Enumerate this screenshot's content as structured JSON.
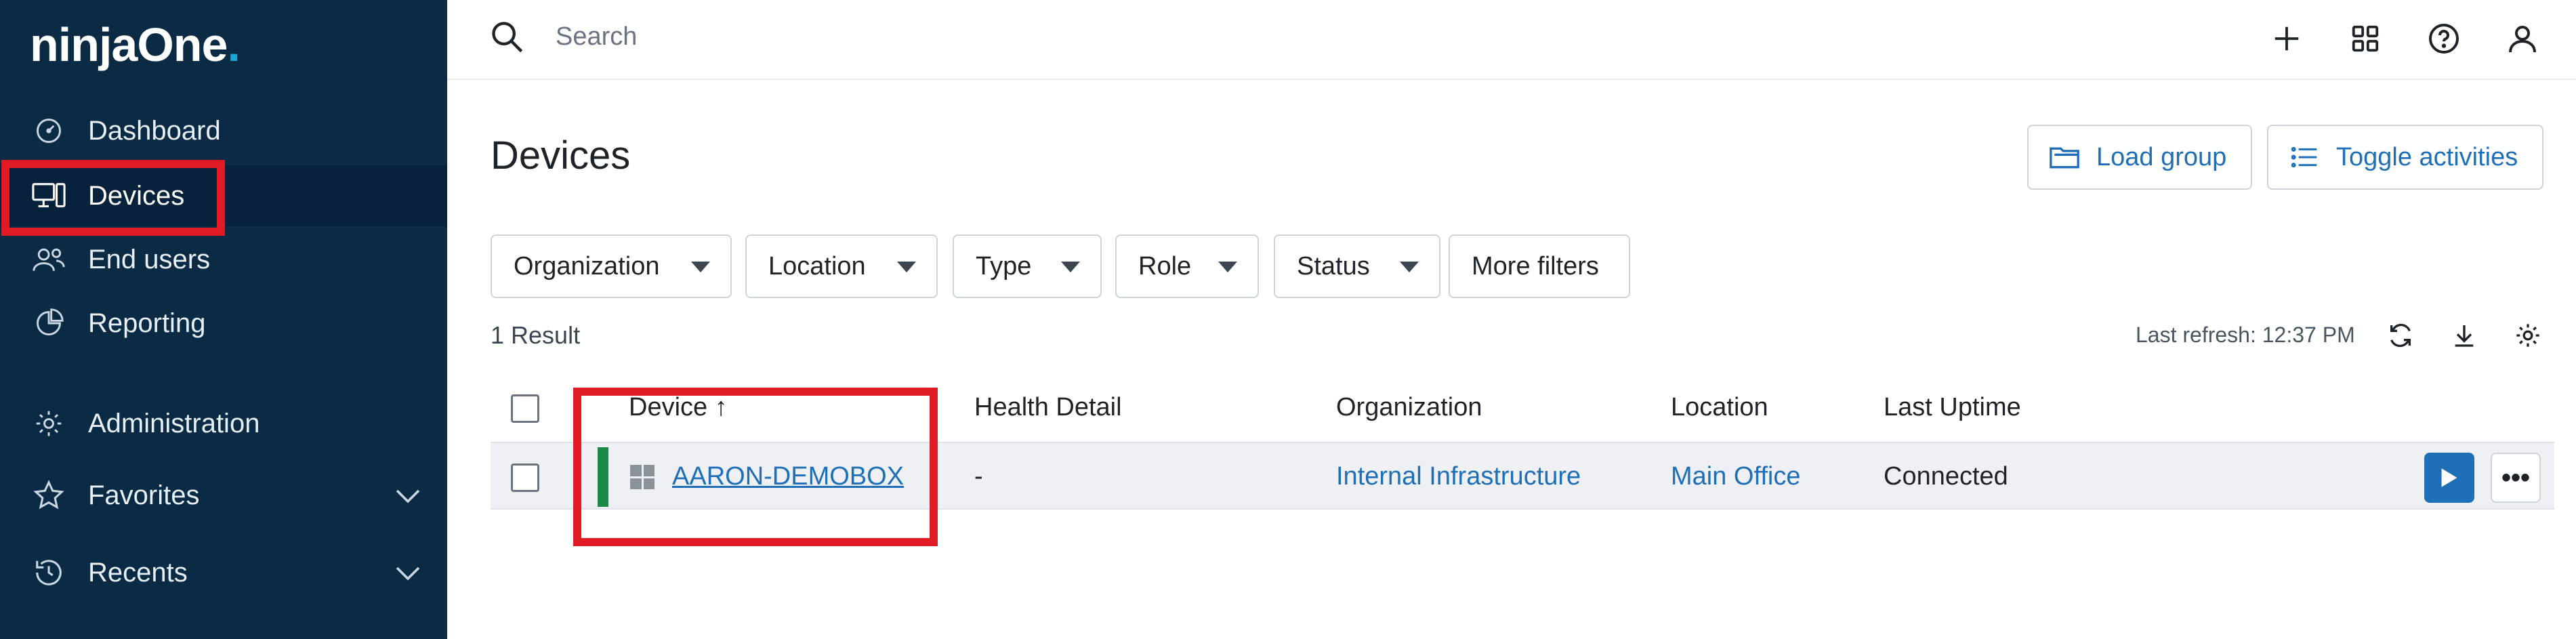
{
  "app": {
    "brand_text": "ninjaOne",
    "brand_dot": "."
  },
  "sidebar": {
    "items": [
      {
        "label": "Dashboard",
        "icon": "dashboard-icon"
      },
      {
        "label": "Devices",
        "icon": "devices-icon",
        "active": true
      },
      {
        "label": "End users",
        "icon": "users-icon"
      },
      {
        "label": "Reporting",
        "icon": "reporting-icon"
      },
      {
        "label": "Administration",
        "icon": "gear-icon"
      },
      {
        "label": "Favorites",
        "icon": "star-icon",
        "expandable": true
      },
      {
        "label": "Recents",
        "icon": "history-icon",
        "expandable": true
      }
    ]
  },
  "topbar": {
    "search_placeholder": "Search",
    "icons": [
      "plus-icon",
      "apps-grid-icon",
      "help-icon",
      "user-icon"
    ]
  },
  "page": {
    "title": "Devices",
    "load_group_label": "Load group",
    "toggle_activities_label": "Toggle activities"
  },
  "filters": [
    {
      "label": "Organization"
    },
    {
      "label": "Location"
    },
    {
      "label": "Type"
    },
    {
      "label": "Role"
    },
    {
      "label": "Status"
    }
  ],
  "more_filters_label": "More filters",
  "results": {
    "count_text": "1 Result",
    "last_refresh_text": "Last refresh: 12:37 PM"
  },
  "table": {
    "columns": [
      "Device ↑",
      "Health Detail",
      "Organization",
      "Location",
      "Last Uptime"
    ],
    "rows": [
      {
        "device": "AARON-DEMOBOX",
        "os_icon": "windows-icon",
        "health": "-",
        "organization": "Internal Infrastructure",
        "location": "Main Office",
        "last_uptime": "Connected",
        "status_color": "#1b8a46"
      }
    ]
  },
  "colors": {
    "sidebar_bg": "#0b2a44",
    "accent": "#1f6fb8",
    "highlight": "#e01b24"
  }
}
